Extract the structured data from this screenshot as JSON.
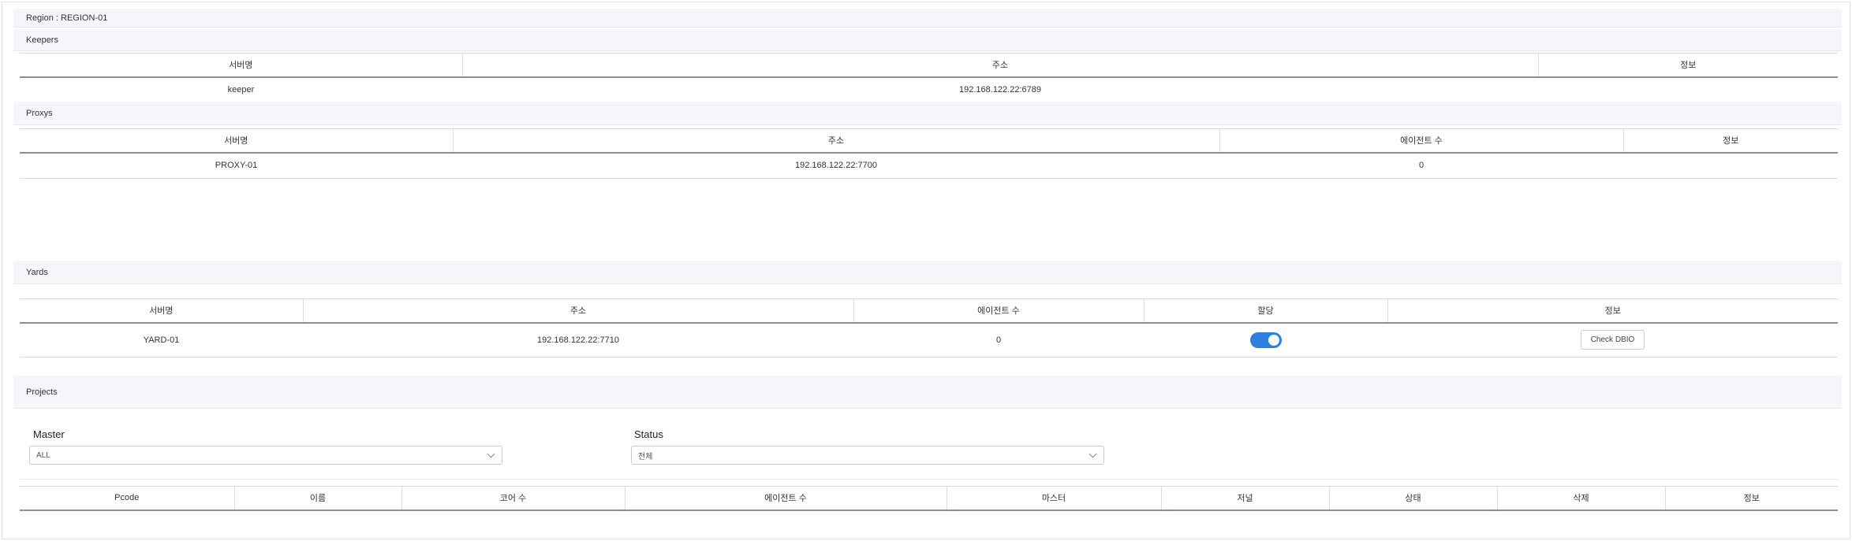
{
  "region": {
    "title": "Region : REGION-01"
  },
  "keepers": {
    "title": "Keepers",
    "headers": [
      "서버명",
      "주소",
      "정보"
    ],
    "rows": [
      {
        "name": "keeper",
        "address": "192.168.122.22:6789",
        "info": ""
      }
    ]
  },
  "proxys": {
    "title": "Proxys",
    "headers": [
      "서버명",
      "주소",
      "에이전트 수",
      "정보"
    ],
    "rows": [
      {
        "name": "PROXY-01",
        "address": "192.168.122.22:7700",
        "agents": "0",
        "info": ""
      }
    ]
  },
  "yards": {
    "title": "Yards",
    "headers": [
      "서버명",
      "주소",
      "에이전트 수",
      "할당",
      "정보"
    ],
    "rows": [
      {
        "name": "YARD-01",
        "address": "192.168.122.22:7710",
        "agents": "0",
        "assigned": true,
        "check_label": "Check DBIO"
      }
    ]
  },
  "projects": {
    "title": "Projects",
    "filters": {
      "master_label": "Master",
      "master_value": "ALL",
      "status_label": "Status",
      "status_value": "전체"
    },
    "headers": [
      "Pcode",
      "이름",
      "코어 수",
      "에이전트 수",
      "마스터",
      "저널",
      "상태",
      "삭제",
      "정보"
    ]
  },
  "colors": {
    "accent": "#2a7fe0",
    "header_bg": "#f5f6fa"
  }
}
